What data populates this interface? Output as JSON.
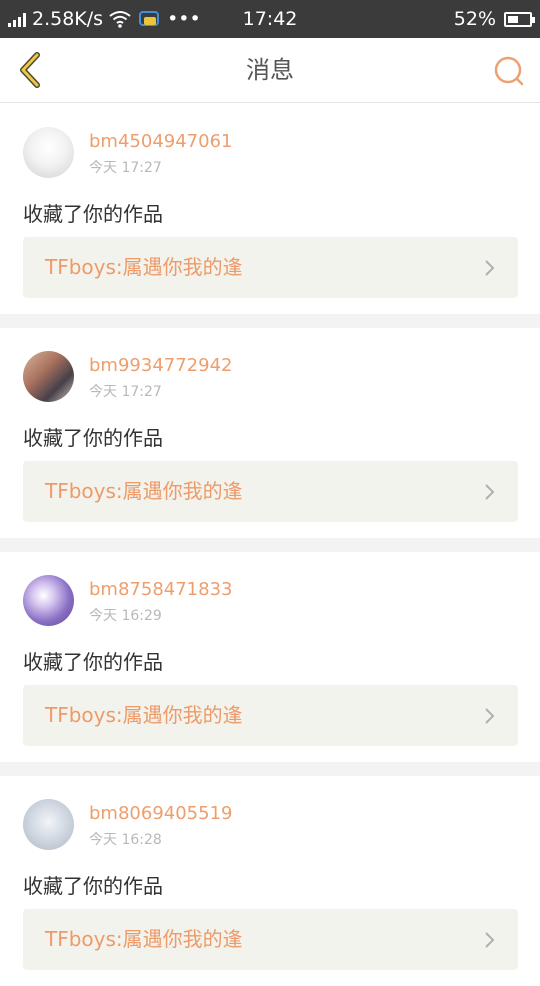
{
  "status_bar": {
    "network_speed": "2.58K/s",
    "dots": "•••",
    "time": "17:42",
    "battery": "52%",
    "battery_level": 0.52
  },
  "header": {
    "title": "消息",
    "back_icon": "chevron-left-icon",
    "search_icon": "search-icon",
    "accent_color": "#e8b33b",
    "search_color": "#f0a070"
  },
  "messages": [
    {
      "username": "bm4504947061",
      "time": "今天 17:27",
      "action": "收藏了你的作品",
      "work_title": "TFboys:属遇你我的逢"
    },
    {
      "username": "bm9934772942",
      "time": "今天 17:27",
      "action": "收藏了你的作品",
      "work_title": "TFboys:属遇你我的逢"
    },
    {
      "username": "bm8758471833",
      "time": "今天 16:29",
      "action": "收藏了你的作品",
      "work_title": "TFboys:属遇你我的逢"
    },
    {
      "username": "bm8069405519",
      "time": "今天 16:28",
      "action": "收藏了你的作品",
      "work_title": "TFboys:属遇你我的逢"
    }
  ],
  "colors": {
    "username": "#ee9e6c",
    "work_title": "#ee9a69",
    "link_bg": "#f3f3ed"
  }
}
